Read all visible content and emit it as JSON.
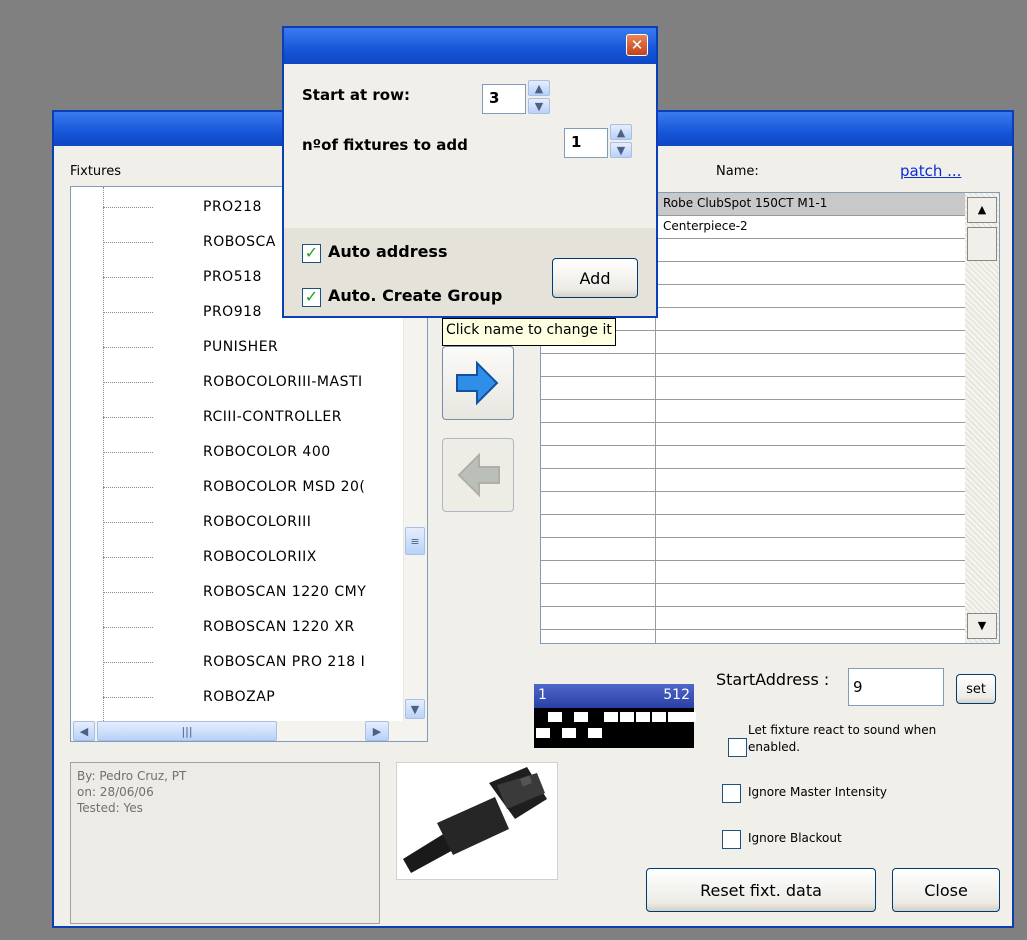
{
  "main_window": {
    "title": "",
    "fixtures_label": "Fixtures",
    "name_label": "Name:",
    "patch_link": "patch ..."
  },
  "tree": {
    "items": [
      "PRO218",
      "ROBOSCA",
      "PRO518",
      "PRO918",
      "PUNISHER",
      "ROBOCOLORIII-MASTI",
      "RCIII-CONTROLLER",
      "ROBOCOLOR 400",
      "ROBOCOLOR MSD 20(",
      "ROBOCOLORIII",
      "ROBOCOLORIIX",
      "ROBOSCAN 1220 CMY",
      "ROBOSCAN 1220 XR",
      "ROBOSCAN PRO 218 I",
      "ROBOZAP"
    ]
  },
  "info": {
    "by": "By: Pedro Cruz, PT",
    "on": "on: 28/06/06",
    "tested": "Tested: Yes"
  },
  "patch_grid": {
    "rows": [
      "Robe ClubSpot 150CT M1-1",
      "Centerpiece-2",
      "",
      "",
      "",
      "",
      "",
      "",
      "",
      "",
      "",
      "",
      "",
      "",
      "",
      "",
      "",
      "",
      "",
      ""
    ]
  },
  "tooltip": "Click name to change it",
  "dmx": {
    "start": "1",
    "end": "512"
  },
  "start_address": {
    "label": "StartAddress :",
    "value": "9",
    "set_label": "set"
  },
  "options": {
    "sound_label": "Let fixture react to sound when enabled.",
    "sound_line1": "Let fixture react to sound when",
    "sound_line2": "enabled.",
    "ignore_master": "Ignore Master Intensity",
    "ignore_blackout": "Ignore Blackout"
  },
  "buttons": {
    "reset": "Reset fixt. data",
    "close": "Close"
  },
  "popup": {
    "start_row_label": "Start at row:",
    "start_row_value": "3",
    "count_label": "nºof fixtures to add",
    "count_value": "1",
    "auto_address": "Auto address",
    "auto_group": "Auto. Create Group",
    "add_label": "Add",
    "auto_address_checked": true,
    "auto_group_checked": true
  },
  "colors": {
    "titlebar": "#1656d8",
    "accent_blue": "#2a3fa4",
    "tooltip_bg": "#ffffe1"
  }
}
